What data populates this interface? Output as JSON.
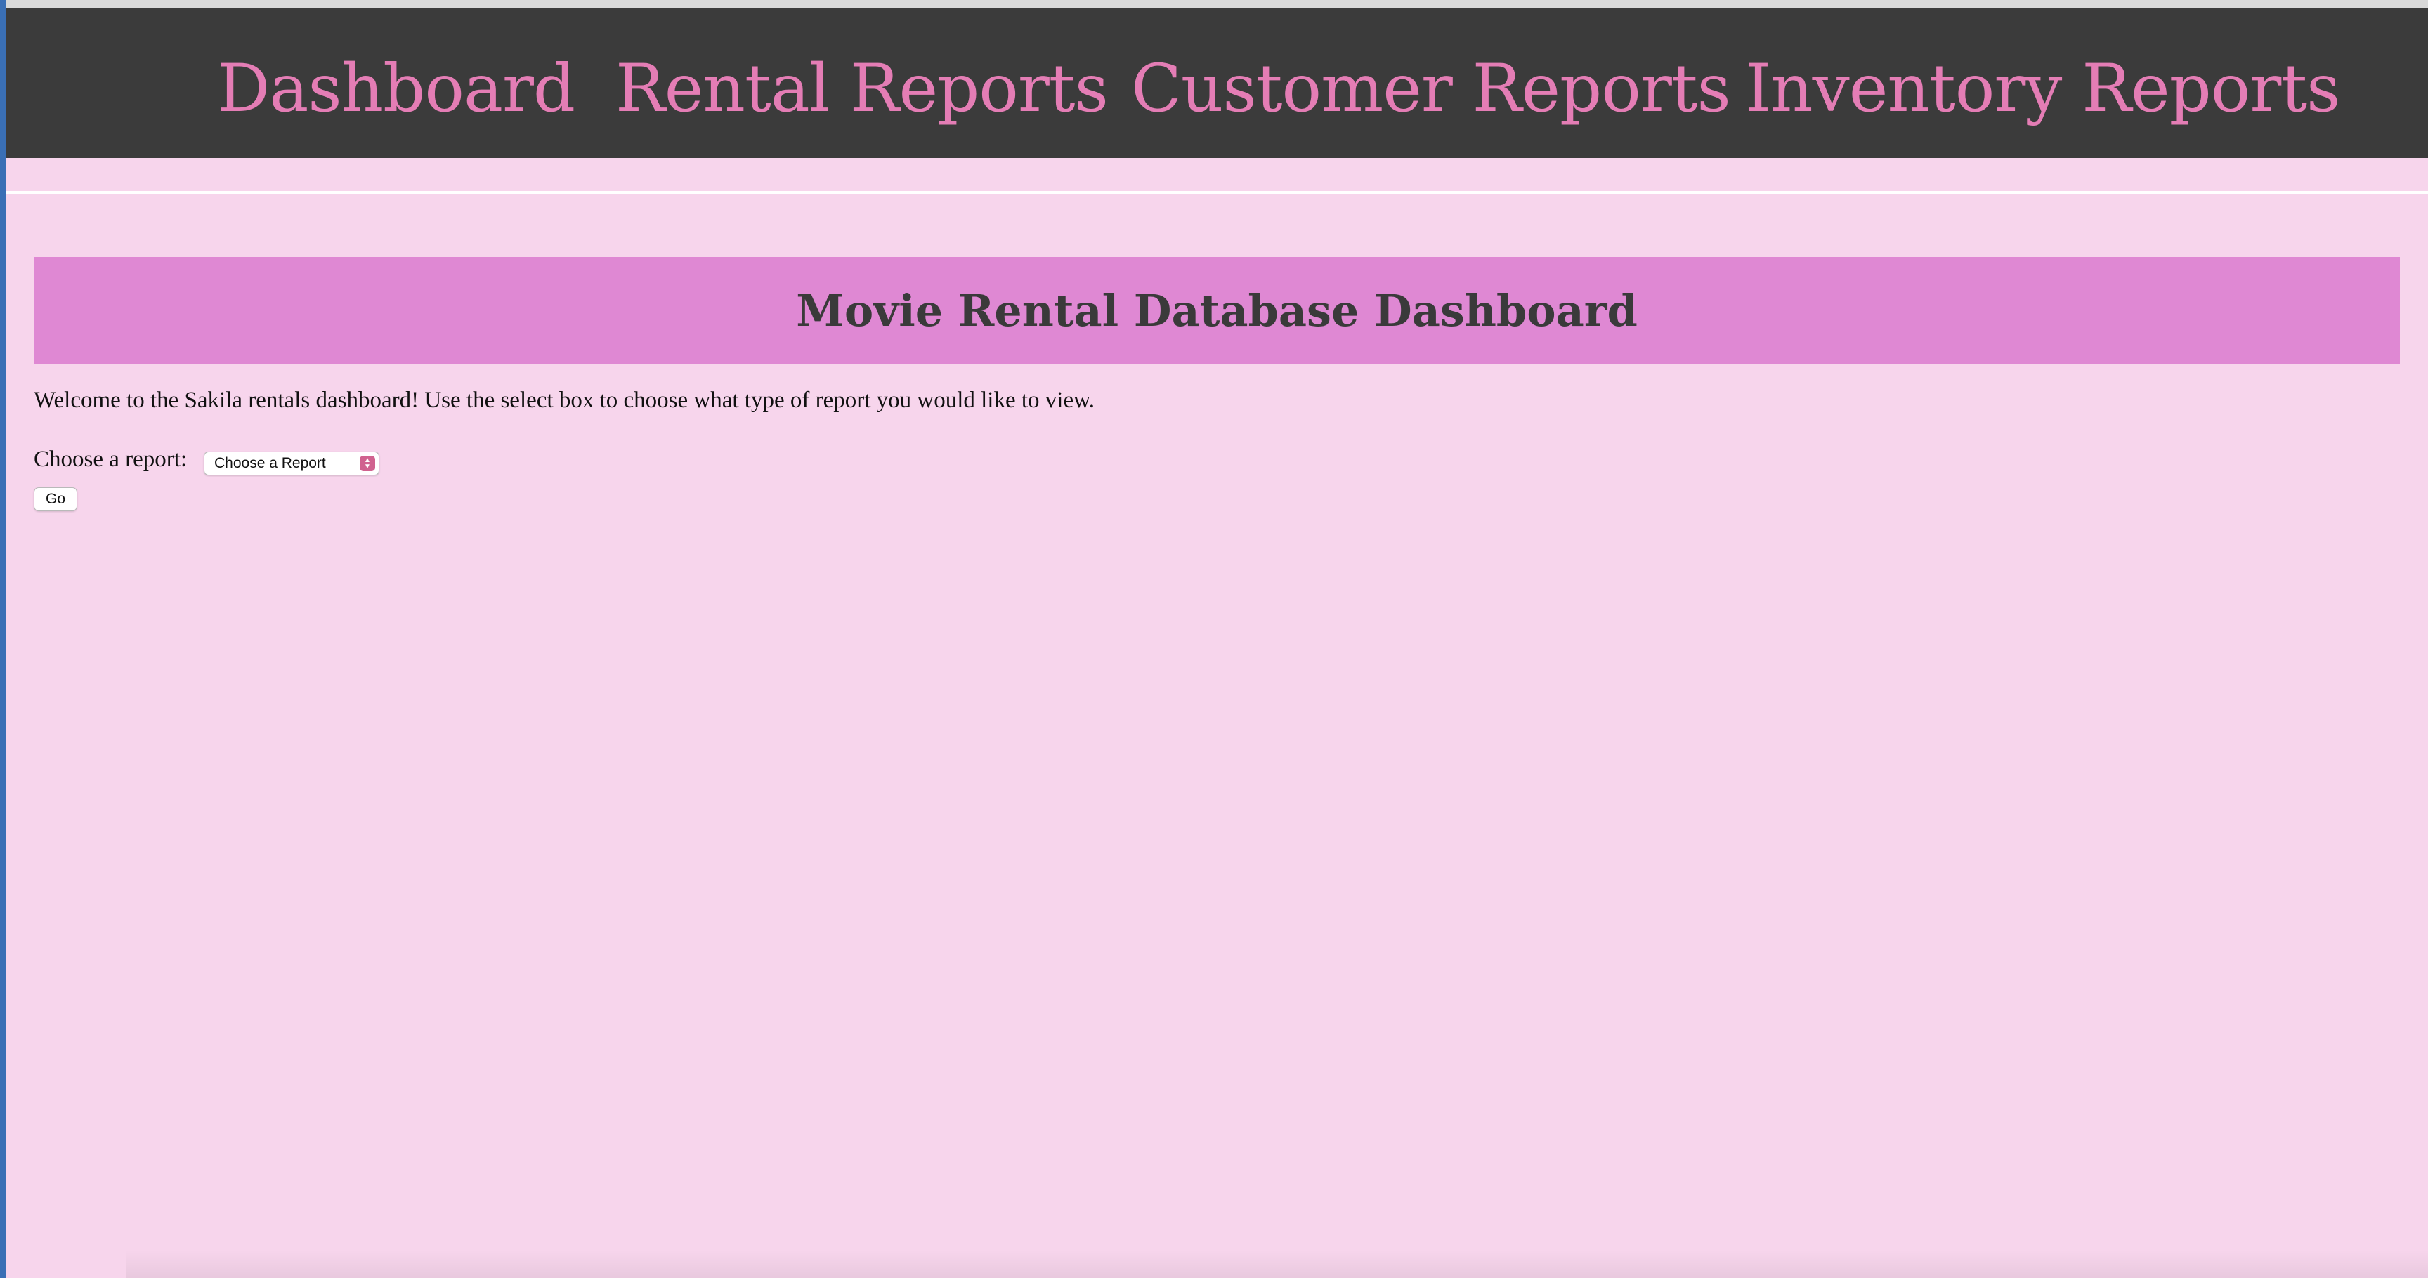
{
  "nav": {
    "items": [
      {
        "label": "Dashboard"
      },
      {
        "label": "Rental Reports"
      },
      {
        "label": "Customer Reports"
      },
      {
        "label": "Inventory Reports"
      }
    ]
  },
  "main": {
    "title": "Movie Rental Database Dashboard",
    "welcome": "Welcome to the Sakila rentals dashboard! Use the select box to choose what type of report you would like to view.",
    "report_label": "Choose a report:",
    "report_select": {
      "selected": "Choose a Report"
    },
    "go_label": "Go"
  },
  "colors": {
    "background": "#f7d5ec",
    "navbar": "#3b3b3b",
    "nav_link": "#e47db5",
    "banner": "#df88d3",
    "title_text": "#3a3a3a",
    "select_accent": "#d0628f"
  },
  "icons": {
    "select_arrow": "up-down-chevron-icon"
  }
}
